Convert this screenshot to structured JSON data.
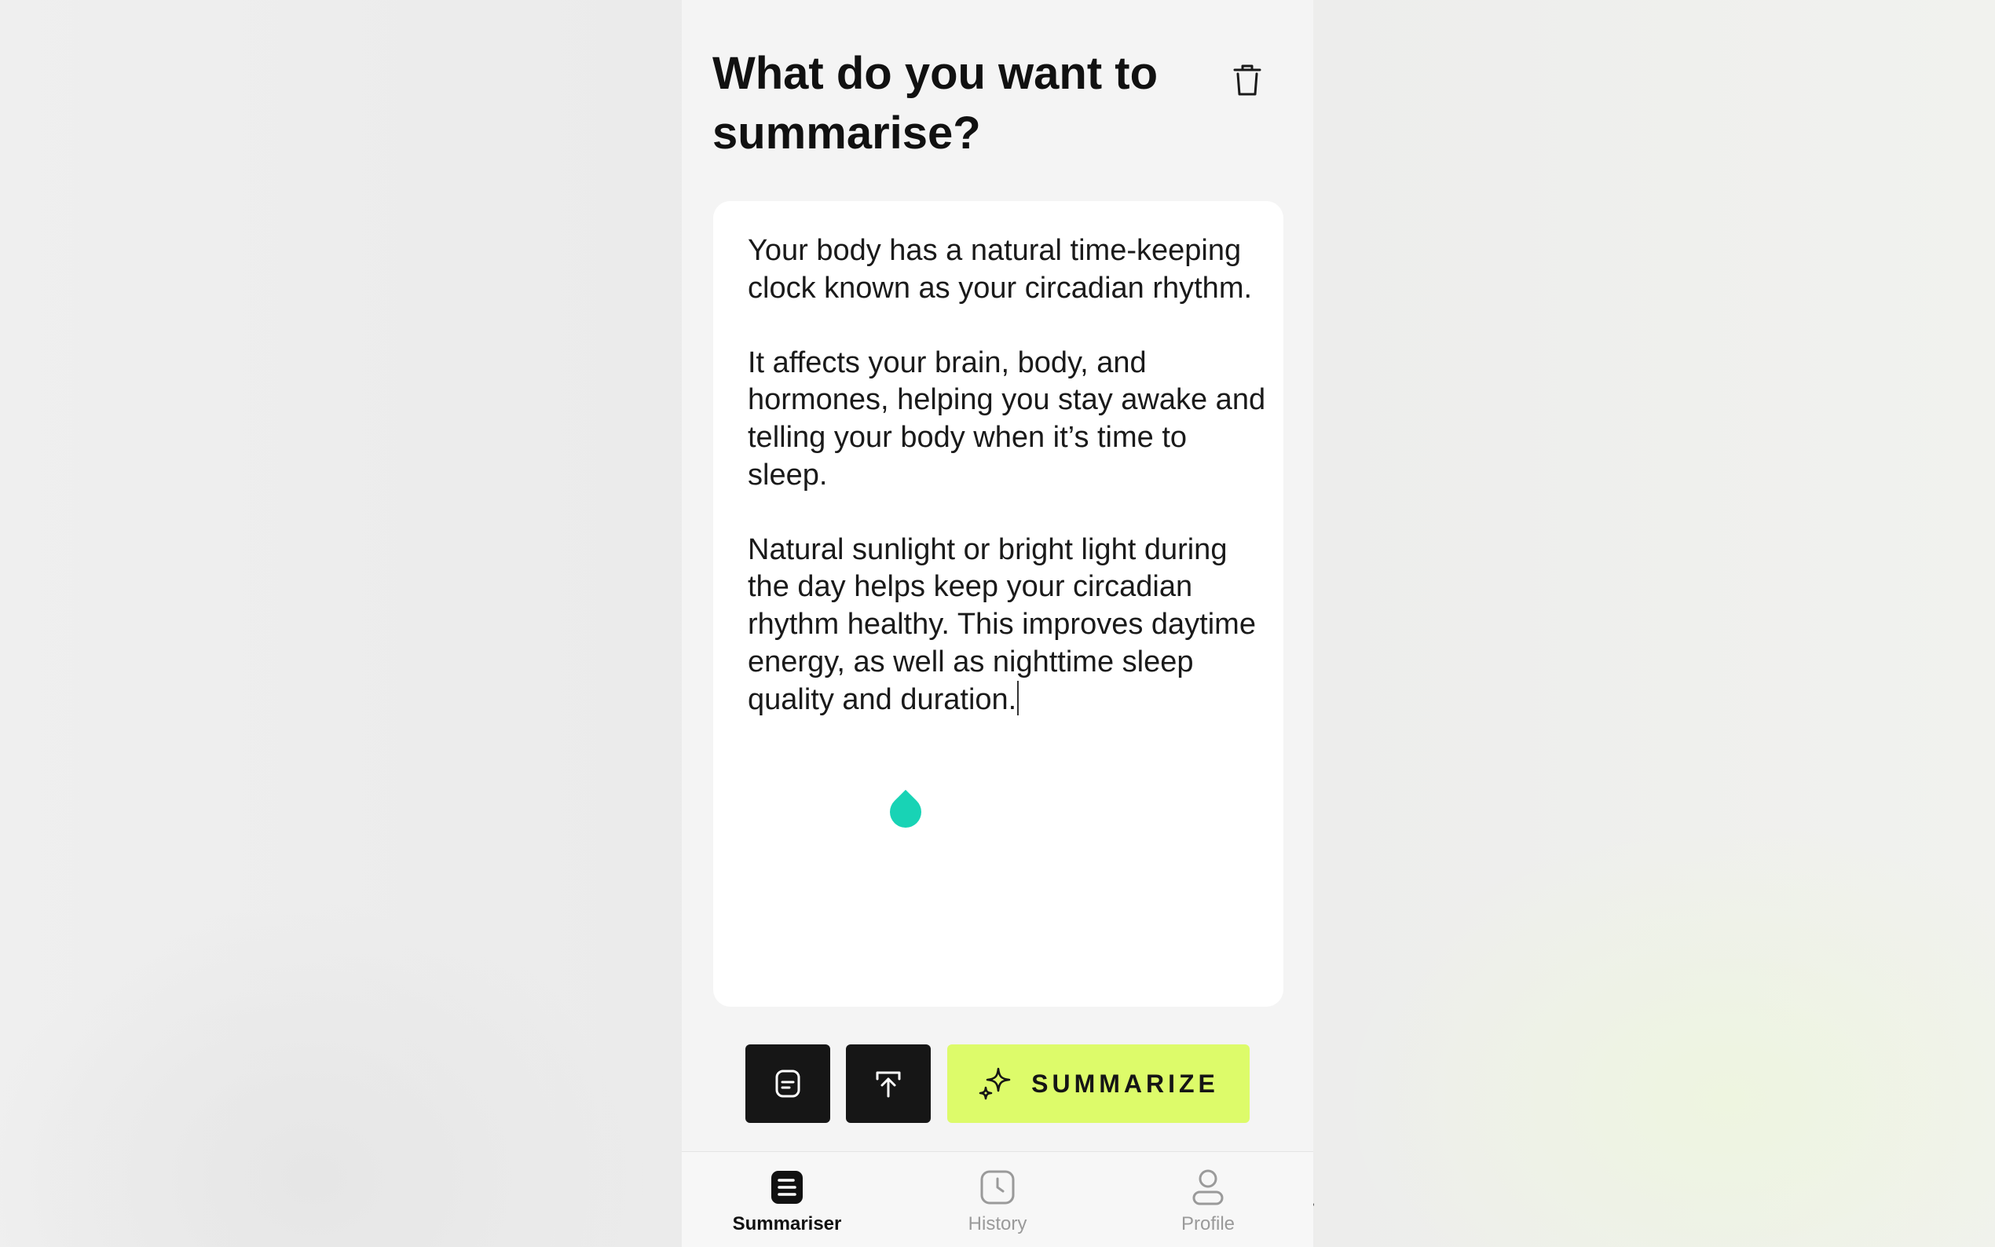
{
  "header": {
    "title": "What do you want to summarise?"
  },
  "editor": {
    "paragraph_1": "Your body has a natural time-keeping clock known as your circadian rhythm.",
    "paragraph_2": "It affects your brain, body, and hormones, helping you stay awake and telling your body when it’s time to sleep.",
    "paragraph_3": "Natural sunlight or bright light during the day helps keep your circadian rhythm healthy. This improves daytime energy, as well as nighttime sleep quality and duration."
  },
  "actions": {
    "summarize_label": "SUMMARIZE"
  },
  "tabs": [
    {
      "label": "Summariser",
      "icon": "document-icon",
      "active": true
    },
    {
      "label": "History",
      "icon": "clock-icon",
      "active": false
    },
    {
      "label": "Profile",
      "icon": "person-icon",
      "active": false
    }
  ],
  "colors": {
    "accent": "#ddfb6a",
    "caret_handle": "#18d3b5",
    "dark_button": "#161616"
  }
}
